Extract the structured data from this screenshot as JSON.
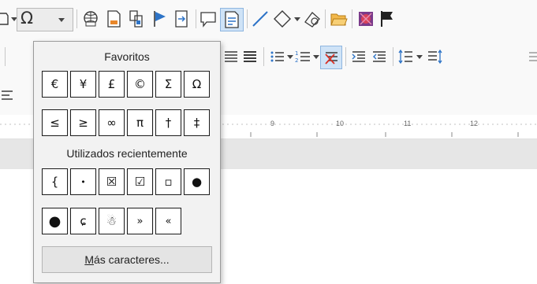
{
  "popup": {
    "favorites_title": "Favoritos",
    "favorites": [
      "€",
      "¥",
      "£",
      "©",
      "Σ",
      "Ω",
      "≤",
      "≥",
      "∞",
      "π",
      "†",
      "‡"
    ],
    "recent_title": "Utilizados recientemente",
    "recent": [
      "{",
      "•",
      "☒",
      "☑",
      "▫",
      "●",
      "●",
      "ɕ",
      "☃",
      "»",
      "«"
    ],
    "more_button_accel": "M",
    "more_button_rest": "ás caracteres..."
  },
  "ruler": {
    "ticks": [
      "9",
      "10",
      "11",
      "12"
    ]
  },
  "colors": {
    "accent": "#2e74c7",
    "selected": "#cfe3f7",
    "popup_bg": "#f2f2f2",
    "doc_gray": "#e6e6e6"
  },
  "toolbar": {
    "row1_icons": [
      "shapes-icon",
      "special-character-icon",
      "hyperlink-icon",
      "footnote-icon",
      "page-break-icon",
      "bookmark-icon",
      "cross-reference-icon",
      "comment-icon",
      "track-changes-icon",
      "line-icon",
      "basic-shapes-icon",
      "draw-functions-icon",
      "open-folder-icon",
      "gallery-icon",
      "flag-icon"
    ],
    "row2_icons": [
      "justify-icon",
      "justify-all-icon",
      "bullets-icon",
      "numbering-icon",
      "outline-active-icon",
      "increase-indent-icon",
      "decrease-indent-icon",
      "line-spacing-icon",
      "paragraph-spacing-icon"
    ]
  }
}
